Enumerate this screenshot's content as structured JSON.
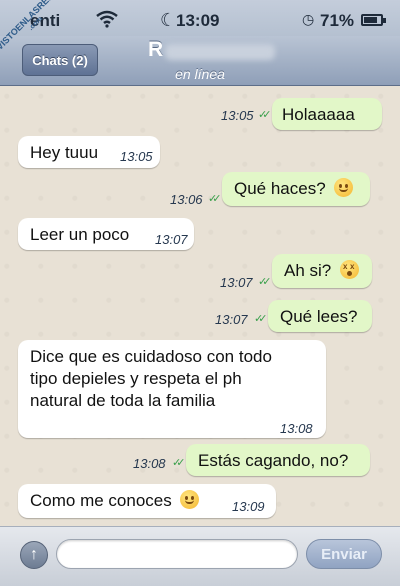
{
  "status_bar": {
    "carrier": "enti",
    "time": "13:09",
    "battery_percent": "71%",
    "battery_level": 0.71,
    "icons": [
      "wifi-icon",
      "moon-icon",
      "alarm-icon",
      "battery-icon"
    ]
  },
  "watermark": {
    "text": "VISTOENLASREDES",
    "sub": ".com"
  },
  "nav": {
    "back_label": "Chats (2)",
    "contact_initial": "R",
    "contact_status": "en línea"
  },
  "messages": [
    {
      "direction": "out",
      "text": "Holaaaaa",
      "time": "13:05",
      "read": true
    },
    {
      "direction": "in",
      "text": "Hey tuuu",
      "time": "13:05"
    },
    {
      "direction": "out",
      "text": "Qué haces?",
      "time": "13:06",
      "read": true,
      "emoji": "smile-emoji"
    },
    {
      "direction": "in",
      "text": "Leer un poco",
      "time": "13:07"
    },
    {
      "direction": "out",
      "text": "Ah si?",
      "time": "13:07",
      "read": true,
      "emoji": "shocked-emoji"
    },
    {
      "direction": "out",
      "text": "Qué lees?",
      "time": "13:07",
      "read": true
    },
    {
      "direction": "in",
      "text": "Dice que es cuidadoso con todo tipo depieles y respeta el ph natural de toda la familia",
      "time": "13:08"
    },
    {
      "direction": "out",
      "text": "Estás cagando, no?",
      "time": "13:08",
      "read": true
    },
    {
      "direction": "in",
      "text": "Como me conoces",
      "time": "13:09",
      "emoji": "blush-emoji"
    }
  ],
  "input_bar": {
    "placeholder": "",
    "send_label": "Enviar",
    "attach_icon": "upload-arrow-icon"
  },
  "colors": {
    "outgoing_bubble": "#e2f7c8",
    "incoming_bubble": "#ffffff",
    "read_check": "#3aa04b",
    "nav_bar": "#8f9fb8"
  }
}
